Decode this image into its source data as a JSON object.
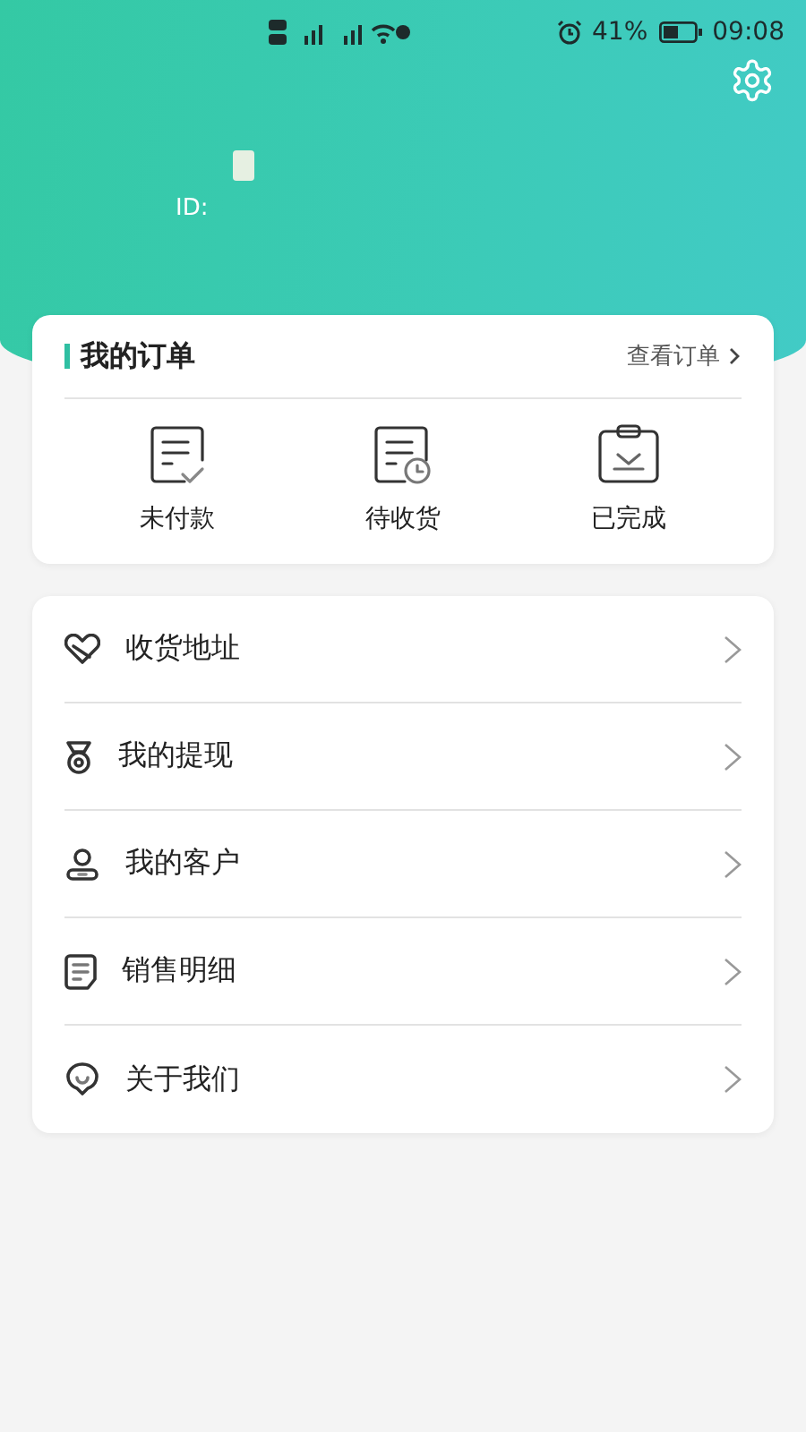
{
  "status_bar": {
    "battery_text": "41%",
    "time": "09:08"
  },
  "profile": {
    "id_label": "ID:"
  },
  "orders": {
    "title": "我的订单",
    "view_all": "查看订单",
    "items": [
      {
        "label": "未付款",
        "kind": "unpaid"
      },
      {
        "label": "待收货",
        "kind": "shipping"
      },
      {
        "label": "已完成",
        "kind": "done"
      }
    ]
  },
  "menu": [
    {
      "label": "收货地址",
      "kind": "address"
    },
    {
      "label": "我的提现",
      "kind": "withdraw"
    },
    {
      "label": "我的客户",
      "kind": "customers"
    },
    {
      "label": "销售明细",
      "kind": "sales"
    },
    {
      "label": "关于我们",
      "kind": "about"
    }
  ]
}
